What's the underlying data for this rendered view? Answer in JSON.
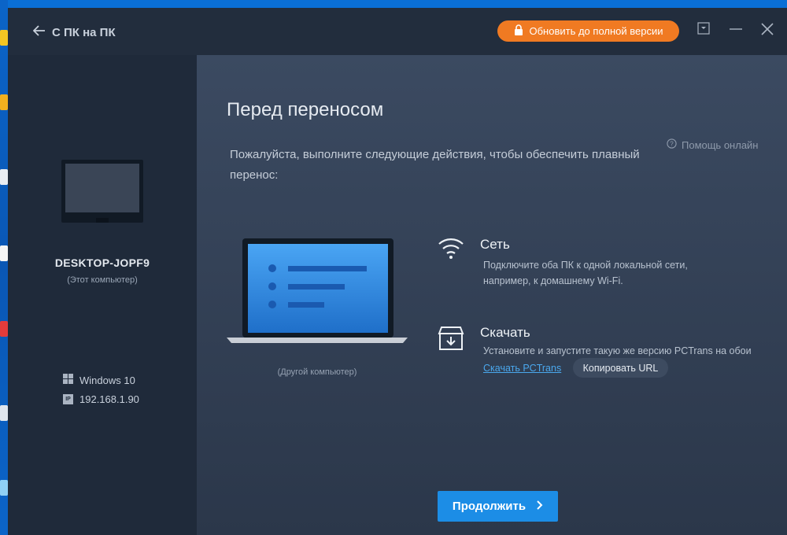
{
  "window": {
    "back_label": "С ПК на ПК",
    "upgrade_label": "Обновить до полной версии"
  },
  "sidebar": {
    "pc_name": "DESKTOP-JOPF9",
    "pc_sub": "(Этот компьютер)",
    "os": "Windows 10",
    "ip_badge": "IP",
    "ip": "192.168.1.90"
  },
  "main": {
    "title": "Перед переносом",
    "help_label": "Помощь онлайн",
    "intro": "Пожалуйста, выполните следующие действия, чтобы обеспечить плавный перенос:",
    "other_pc_label": "(Другой компьютер)",
    "network": {
      "title": "Сеть",
      "line1": "Подключите оба ПК к одной локальной сети,",
      "line2": "например, к домашнему Wi-Fi."
    },
    "download": {
      "title": "Скачать",
      "desc": "Установите и запустите такую же версию PCTrans на обои",
      "link": "Скачать PCTrans",
      "copy_label": "Копировать URL"
    },
    "continue_label": "Продолжить"
  },
  "colors": {
    "accent_orange": "#f07a22",
    "accent_blue": "#1c8de6",
    "link_blue": "#4aa8ee",
    "sidebar_bg": "#1f2a3a",
    "titlebar_bg": "#222d3d"
  }
}
